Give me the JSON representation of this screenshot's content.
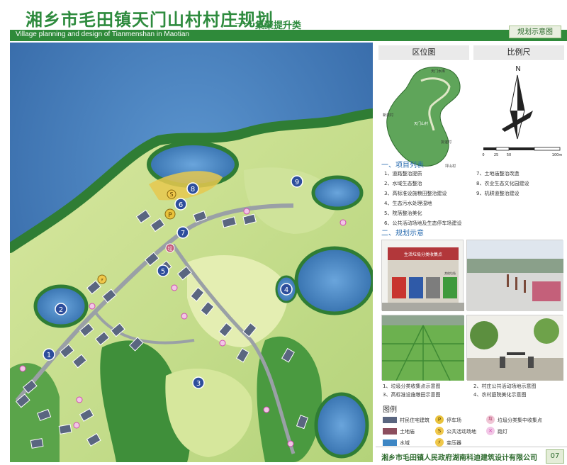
{
  "header": {
    "title_cn": "湘乡市毛田镇天门山村村庄规划",
    "category": "集聚提升类",
    "title_en": "Village planning and design of Tianmenshan in Maotian",
    "doc_type": "规划示意图"
  },
  "panel": {
    "location_title": "区位图",
    "scale_title": "比例尺",
    "north_label": "N",
    "scale_ticks": [
      "0",
      "25",
      "50",
      "100m"
    ],
    "location_map_labels": [
      "新泉村",
      "天门山村",
      "友谊村",
      "坪山村",
      "天门水库"
    ]
  },
  "project_list": {
    "title": "一、项目列表",
    "items": [
      "1、道路整治提质",
      "2、水域生态整治",
      "3、高标准设施粮田整治建设",
      "4、生态污水处理湿地",
      "5、院落整治美化",
      "6、公共活动场地及生态停车场建设",
      "7、土地庙整治改造",
      "8、农业生态文化园建设",
      "9、机耕道整治建设"
    ]
  },
  "planning_diagram": {
    "title": "二、规划示意",
    "photo_texts": [
      "生活垃圾分类收集点",
      "其他垃圾"
    ],
    "captions": [
      "1、垃圾分类收集点示意图",
      "2、村庄公共活动场地示意图",
      "3、高标准设施粮田示意图",
      "4、农村庭院美化示意图"
    ]
  },
  "legend": {
    "title": "图例",
    "items": [
      {
        "label": "村民住宅建筑",
        "color": "#5a6680"
      },
      {
        "label": "停车场",
        "symbol": "P"
      },
      {
        "label": "垃圾分类集中收集点",
        "symbol": "垃"
      },
      {
        "label": "土地庙",
        "color": "#8c4e5e"
      },
      {
        "label": "公共活动场地",
        "symbol": "S"
      },
      {
        "label": "路灯",
        "symbol": "✕"
      },
      {
        "label": "水域",
        "color": "#3d86c4"
      },
      {
        "label": "变压器",
        "symbol": "⚡"
      }
    ]
  },
  "map": {
    "markers": [
      "1",
      "2",
      "3",
      "4",
      "5",
      "6",
      "7",
      "8",
      "9"
    ],
    "parking_symbol": "P",
    "public_space_symbol": "S",
    "garbage_symbol": "垃"
  },
  "footer": {
    "org": "湘乡市毛田镇人民政府",
    "company": "湖南科迪建筑设计有限公司",
    "page": "07"
  }
}
